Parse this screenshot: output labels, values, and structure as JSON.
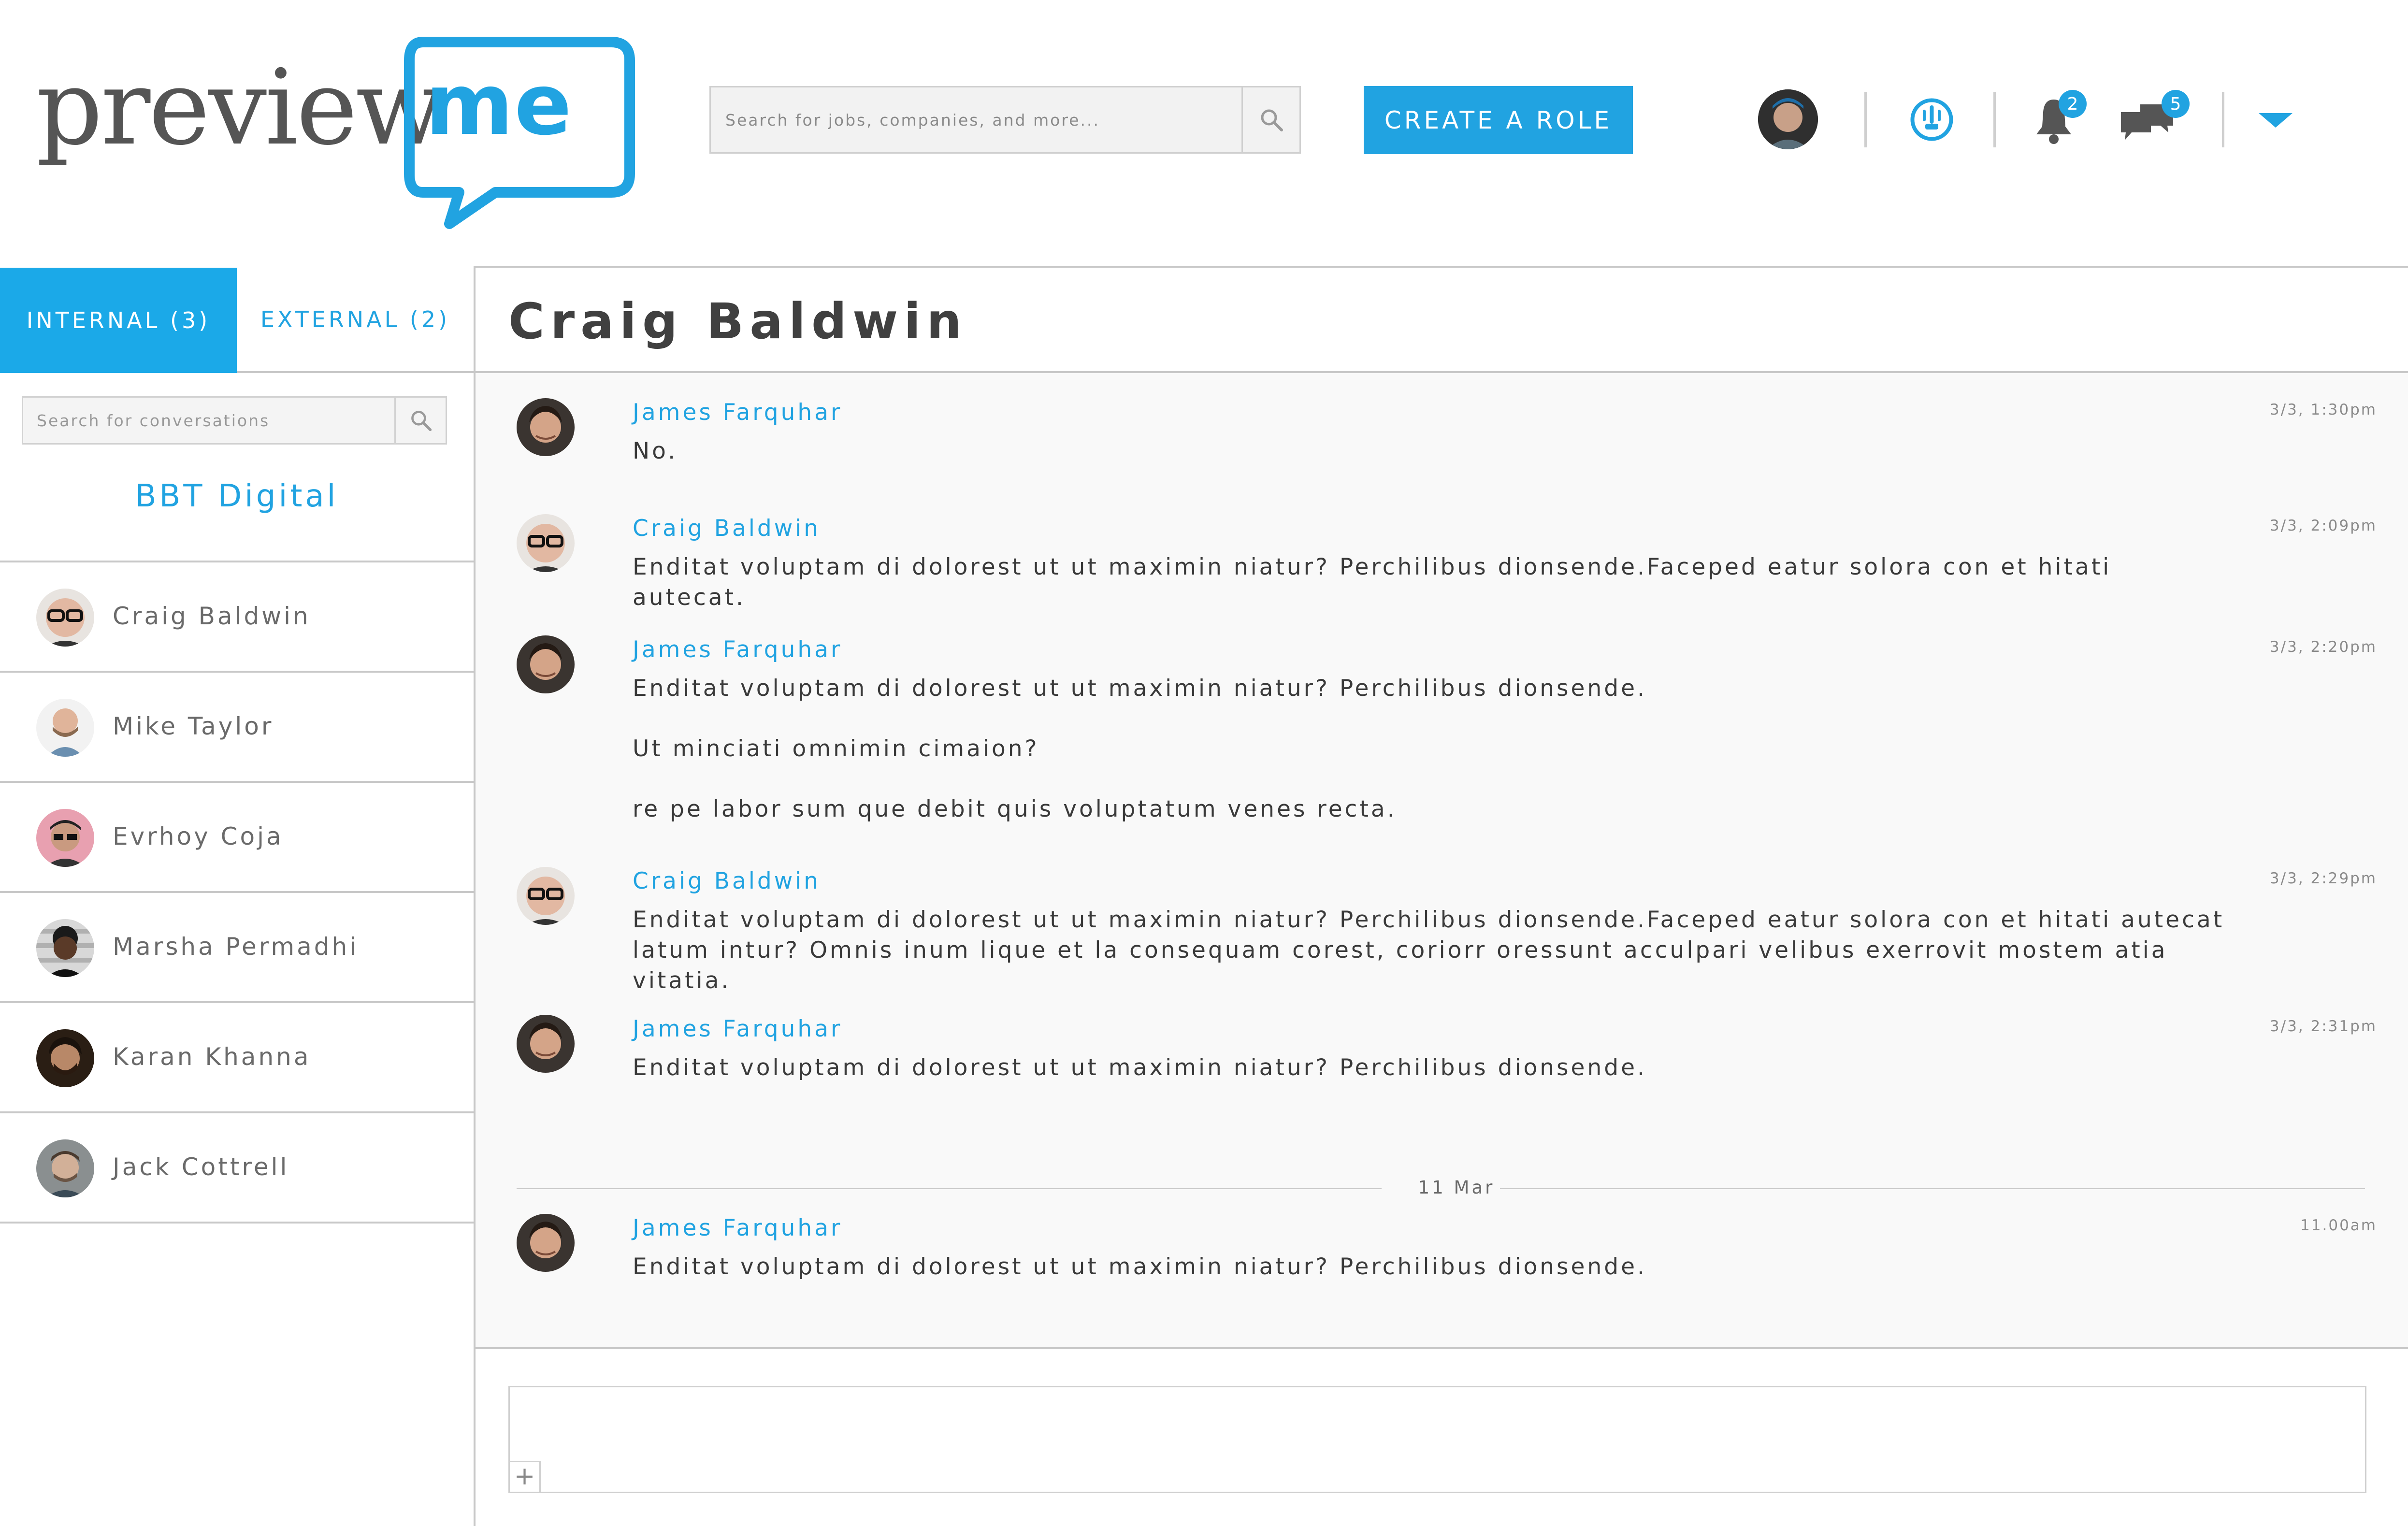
{
  "logo": {
    "text_preview": "preview",
    "text_me": "me"
  },
  "search": {
    "placeholder": "Search for jobs, companies, and more..."
  },
  "header": {
    "create_role_label": "CREATE A ROLE",
    "notifications_count": "2",
    "messages_count": "5"
  },
  "tabs": {
    "internal_label": "INTERNAL (3)",
    "external_label": "EXTERNAL (2)"
  },
  "conversations": {
    "search_placeholder": "Search for conversations",
    "company": "BBT Digital",
    "contacts": [
      {
        "name": "Craig Baldwin"
      },
      {
        "name": "Mike Taylor"
      },
      {
        "name": "Evrhoy Coja"
      },
      {
        "name": "Marsha Permadhi"
      },
      {
        "name": "Karan Khanna"
      },
      {
        "name": "Jack Cottrell"
      }
    ]
  },
  "chat": {
    "title": "Craig Baldwin",
    "messages": [
      {
        "sender": "James Farquhar",
        "time": "3/3, 1:30pm",
        "lines": [
          "No."
        ]
      },
      {
        "sender": "Craig Baldwin",
        "time": "3/3, 2:09pm",
        "lines": [
          "Enditat voluptam di dolorest ut ut maximin niatur? Perchilibus dionsende.Faceped eatur solora con et hitati autecat."
        ]
      },
      {
        "sender": "James Farquhar",
        "time": "3/3, 2:20pm",
        "lines": [
          "Enditat voluptam di dolorest ut ut maximin niatur? Perchilibus dionsende.",
          "Ut minciati omnimin cimaion?",
          "re pe labor sum que debit quis voluptatum venes recta."
        ]
      },
      {
        "sender": "Craig Baldwin",
        "time": "3/3, 2:29pm",
        "lines": [
          "Enditat voluptam di dolorest ut ut maximin niatur? Perchilibus dionsende.Faceped eatur solora con et hitati autecat latum intur? Omnis inum lique et la consequam corest, coriorr oressunt accul­pari velibus exerrovit mostem atia vitatia."
        ]
      },
      {
        "sender": "James Farquhar",
        "time": "3/3, 2:31pm",
        "lines": [
          "Enditat voluptam di dolorest ut ut maximin niatur? Perchilibus dionsende."
        ]
      },
      {
        "sender": "James Farquhar",
        "time": "11.00am",
        "lines": [
          "Enditat voluptam di dolorest ut ut maximin niatur? Perchilibus dionsende."
        ]
      }
    ],
    "date_separator": "11 Mar"
  },
  "composer": {
    "add_label": "+"
  },
  "colors": {
    "accent": "#21a3e1",
    "tab_active": "#1ba9e8",
    "divider": "#c8c8c8"
  },
  "icons": [
    "search-icon",
    "dashboard-icon",
    "bell-icon",
    "chat-bubbles-icon",
    "chevron-down-icon",
    "plus-icon"
  ]
}
